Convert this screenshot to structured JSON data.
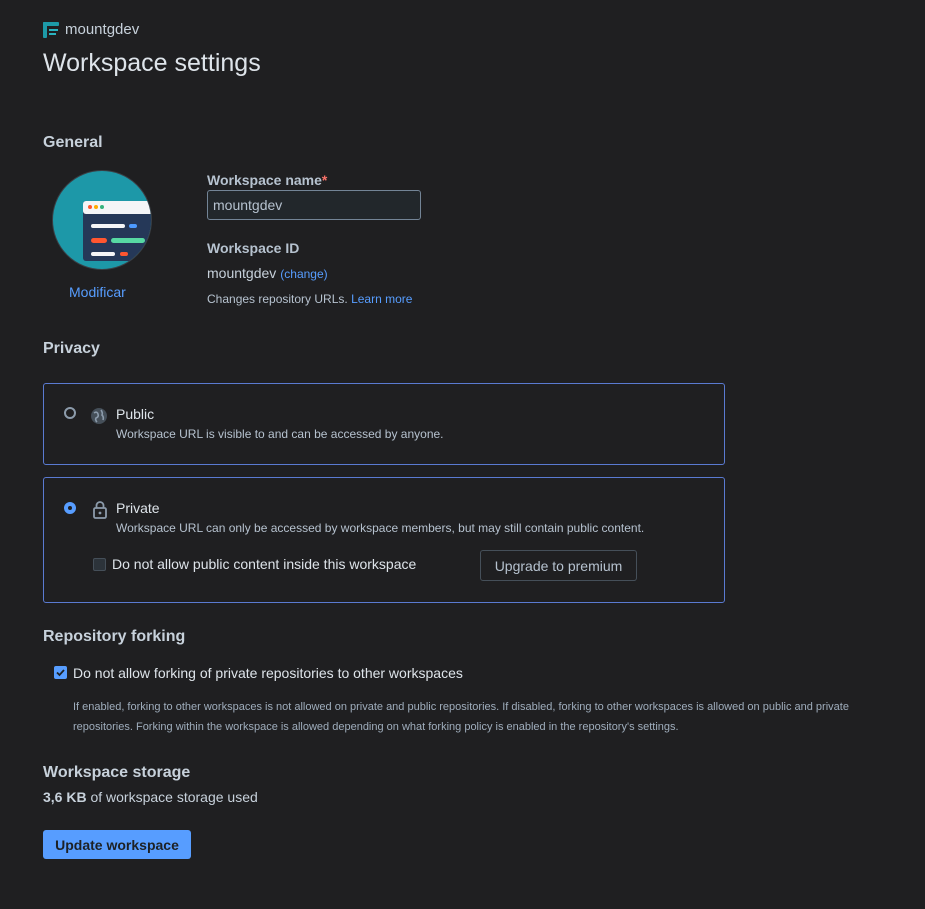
{
  "header": {
    "workspace_crumb": "mountgdev",
    "title": "Workspace settings"
  },
  "general": {
    "heading": "General",
    "avatar_action": "Modificar",
    "name_label": "Workspace name",
    "required_mark": "*",
    "name_value": "mountgdev",
    "id_label": "Workspace ID",
    "id_value": "mountgdev",
    "id_change": "(change)",
    "id_hint": "Changes repository URLs.",
    "id_hint_link": "Learn more"
  },
  "privacy": {
    "heading": "Privacy",
    "options": [
      {
        "title": "Public",
        "description": "Workspace URL is visible to and can be accessed by anyone.",
        "selected": false,
        "icon": "globe-icon"
      },
      {
        "title": "Private",
        "description": "Workspace URL can only be accessed by workspace members, but may still contain public content.",
        "selected": true,
        "icon": "lock-icon"
      }
    ],
    "public_content_checkbox": "Do not allow public content inside this workspace",
    "public_content_checked": false,
    "upgrade_button": "Upgrade to premium"
  },
  "forking": {
    "heading": "Repository forking",
    "checkbox_label": "Do not allow forking of private repositories to other workspaces",
    "checked": true,
    "help_text": "If enabled, forking to other workspaces is not allowed on private and public repositories. If disabled, forking to other workspaces is allowed on public and private repositories. Forking within the workspace is allowed depending on what forking policy is enabled in the repository's settings."
  },
  "storage": {
    "heading": "Workspace storage",
    "amount": "3,6 KB",
    "suffix": "of workspace storage used"
  },
  "actions": {
    "update_button": "Update workspace"
  },
  "colors": {
    "accent": "#579dff",
    "background": "#1f1f21",
    "border_selected": "#5a7ad1",
    "avatar_bg": "#1d98a8"
  }
}
